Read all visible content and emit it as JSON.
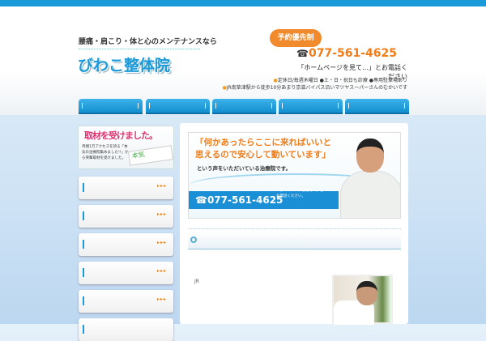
{
  "header": {
    "tagline": "腰痛・肩こり・体と心のメンテナンスなら",
    "logo": "びわこ整体院",
    "reservation": "予約優先制",
    "phone_icon": "☎",
    "phone": "077-561-4625",
    "see_homepage": "「ホームページを見て…」とお電話ください",
    "info_line1": "定休日/毎週木曜日 ●土・日・祝日も診療 ●専用駐車場あり",
    "info_line2": "JR南草津駅から徒歩10分あまり京滋バイパス沿いマツヤスーパーさんのむかいです",
    "bullet": "●"
  },
  "nav": {
    "count": 5
  },
  "sidebar": {
    "banner_title": "取材を受けました。",
    "banner_text": "月間1万アクセスを誇る「本気の治療院集めました!!」から突撃取材を受けました。",
    "banner_card": "本気",
    "arrow": "▸▸▸",
    "button_count": 6
  },
  "main": {
    "quote_line1": "「何かあったらここに来ればいいと",
    "quote_line2": "思えるので安心して動いています」",
    "quote_sub": "という声をいただいている治療院です。",
    "banner_phone": "☎077-561-4625",
    "banner_phone_note": "「ホームページを見て…」とお電話ください。",
    "body_text": "jR"
  }
}
